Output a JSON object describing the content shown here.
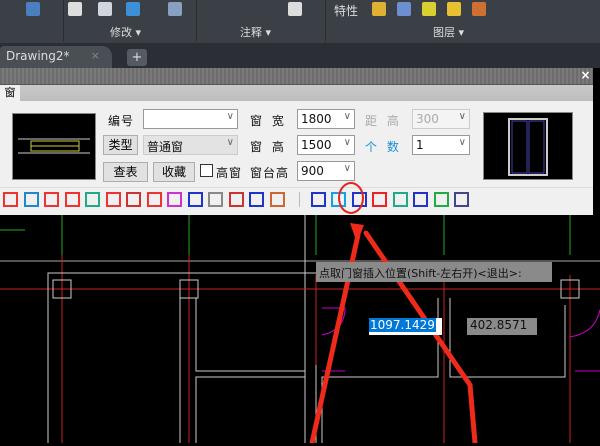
{
  "ribbon": {
    "panels": [
      {
        "label": "修改 ▾"
      },
      {
        "label": "注释 ▾"
      },
      {
        "label": "图层 ▾"
      }
    ],
    "properties_label": "特性"
  },
  "tabs": {
    "document": "Drawing2*",
    "close": "×",
    "add": "+"
  },
  "palette": {
    "close": "×",
    "tab": "窗",
    "fields": {
      "number_label": "编号",
      "number_value": "",
      "type_button": "类型",
      "type_value": "普通窗",
      "lookup_button": "查表",
      "favorite_button": "收藏",
      "high_window_label": "高窗",
      "high_window_checked": false,
      "width_label": "窗 宽",
      "width_value": "1800",
      "height_label": "窗 高",
      "height_value": "1500",
      "sill_label": "窗台高",
      "sill_value": "900",
      "distance_label": "距 高",
      "distance_value": "300",
      "count_label": "个 数",
      "count_value": "1"
    }
  },
  "canvas": {
    "prompt": "点取门窗插入位置(Shift-左右开)<退出>:",
    "dim_input": "1097.1429",
    "dim_other": "402.8571"
  },
  "colors": {
    "accent": "#0078d7",
    "annotation": "#ff2a1a",
    "count_label": "#1a8fd8"
  }
}
